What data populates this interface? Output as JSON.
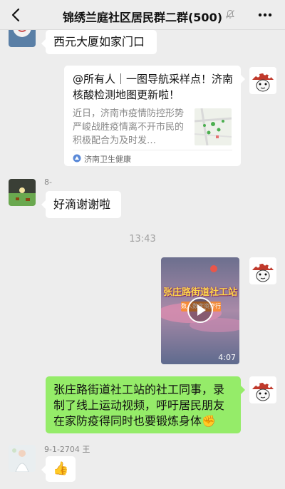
{
  "nav": {
    "title": "锦绣兰庭社区居民群二群(500)",
    "back_icon": "back-chevron-icon",
    "mute_icon": "mute-bell-icon",
    "more_icon": "more-dots-icon"
  },
  "messages": {
    "msg1": {
      "text": "西元大厦如家门口"
    },
    "card": {
      "title": "@所有人｜一图导航采样点！济南核酸检测地图更新啦！",
      "description": "近日，济南市疫情防控形势严峻战胜疫情离不开市民的积极配合为及时发…",
      "source": "济南卫生健康"
    },
    "msg3": {
      "sender": "8-",
      "text": "好滴谢谢啦"
    },
    "timestamp": "13:43",
    "video": {
      "title": "张庄路街道社工站",
      "subtitle": "数人数字资疗行",
      "duration": "4:07"
    },
    "msg5": {
      "text": "张庄路街道社工站的社工同事，录制了线上运动视频，呼吁居民朋友在家防疫得同时也要锻炼身体✊"
    },
    "msg6": {
      "sender": "9-1-2704 王",
      "emoji": "👍"
    }
  },
  "colors": {
    "bubble_green": "#95ec69",
    "background": "#ededed"
  }
}
